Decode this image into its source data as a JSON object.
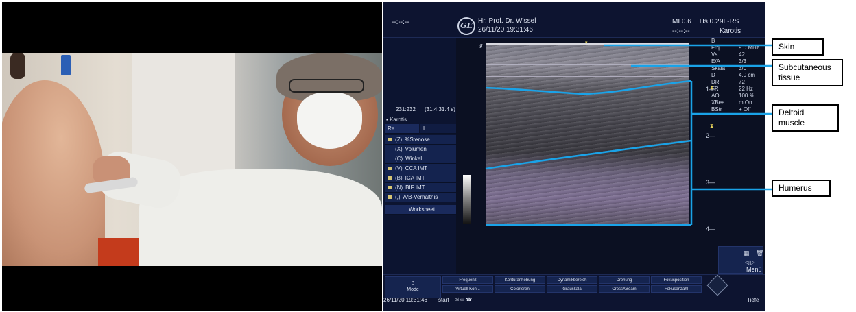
{
  "ultrasound": {
    "header": {
      "time_placeholder": "--:--:--",
      "doctor": "Hr. Prof. Dr. Wissel",
      "datetime": "26/11/20 19:31:46",
      "mi": "MI 0.6",
      "tis": "TIs 0.2",
      "probe": "9L-RS",
      "time_placeholder_right": "--:--:--",
      "preset": "Karotis"
    },
    "left_panel": {
      "counter": "231:232",
      "duration": "(31.4:31.4 s)",
      "preset_item": "Karotis",
      "tab_re": "Re",
      "tab_li": "Li",
      "menu_items": [
        {
          "key": "(Z)",
          "label": "%Stenose",
          "folder": true
        },
        {
          "key": "(X)",
          "label": "Volumen",
          "folder": false
        },
        {
          "key": "(C)",
          "label": "Winkel",
          "folder": false
        },
        {
          "key": "(V)",
          "label": "CCA IMT",
          "folder": true
        },
        {
          "key": "(B)",
          "label": "ICA IMT",
          "folder": true
        },
        {
          "key": "(N)",
          "label": "BIF IMT",
          "folder": true
        },
        {
          "key": "(,)",
          "label": "A/B-Verhältnis",
          "folder": true
        }
      ],
      "worksheet": "Worksheet"
    },
    "right_info": [
      {
        "label": "B",
        "value": ""
      },
      {
        "label": "Frq",
        "value": "9.0 MHz"
      },
      {
        "label": "Vs",
        "value": "42"
      },
      {
        "label": "E/A",
        "value": "3/3"
      },
      {
        "label": "Skala",
        "value": "3/0"
      },
      {
        "label": "D",
        "value": "4.0 cm"
      },
      {
        "label": "DR",
        "value": "72"
      },
      {
        "label": "FR",
        "value": "22 Hz"
      },
      {
        "label": "AO",
        "value": "100 %"
      },
      {
        "label": "XBea",
        "value": "m On"
      },
      {
        "label": "BStr",
        "value": "+ Off"
      }
    ],
    "depth_marks": [
      "1",
      "2",
      "3",
      "4"
    ],
    "menu_label": "Menü",
    "footer": {
      "mode": "B\nMode",
      "soft_keys_top": [
        "Frequenz",
        "Konturanhebung",
        "Dynamikbereich",
        "Drehung",
        "Fokusposition"
      ],
      "soft_keys_bottom": [
        "Virtuell Kon...",
        "Colorieren",
        "Grauskala",
        "CrossXBeam",
        "Fokusanzahl"
      ],
      "datetime": "26/11/20 19:31:46",
      "start": "start",
      "tiefe": "Tiefe"
    }
  },
  "annotations": [
    {
      "id": "skin",
      "label": "Skin"
    },
    {
      "id": "subcutaneous",
      "label": "Subcutaneous tissue"
    },
    {
      "id": "deltoid",
      "label": "Deltoid muscle"
    },
    {
      "id": "humerus",
      "label": "Humerus"
    }
  ],
  "colors": {
    "annotation_line": "#1aa3e8",
    "screen_bg": "#0b1022",
    "menu_bg": "#14234f"
  }
}
